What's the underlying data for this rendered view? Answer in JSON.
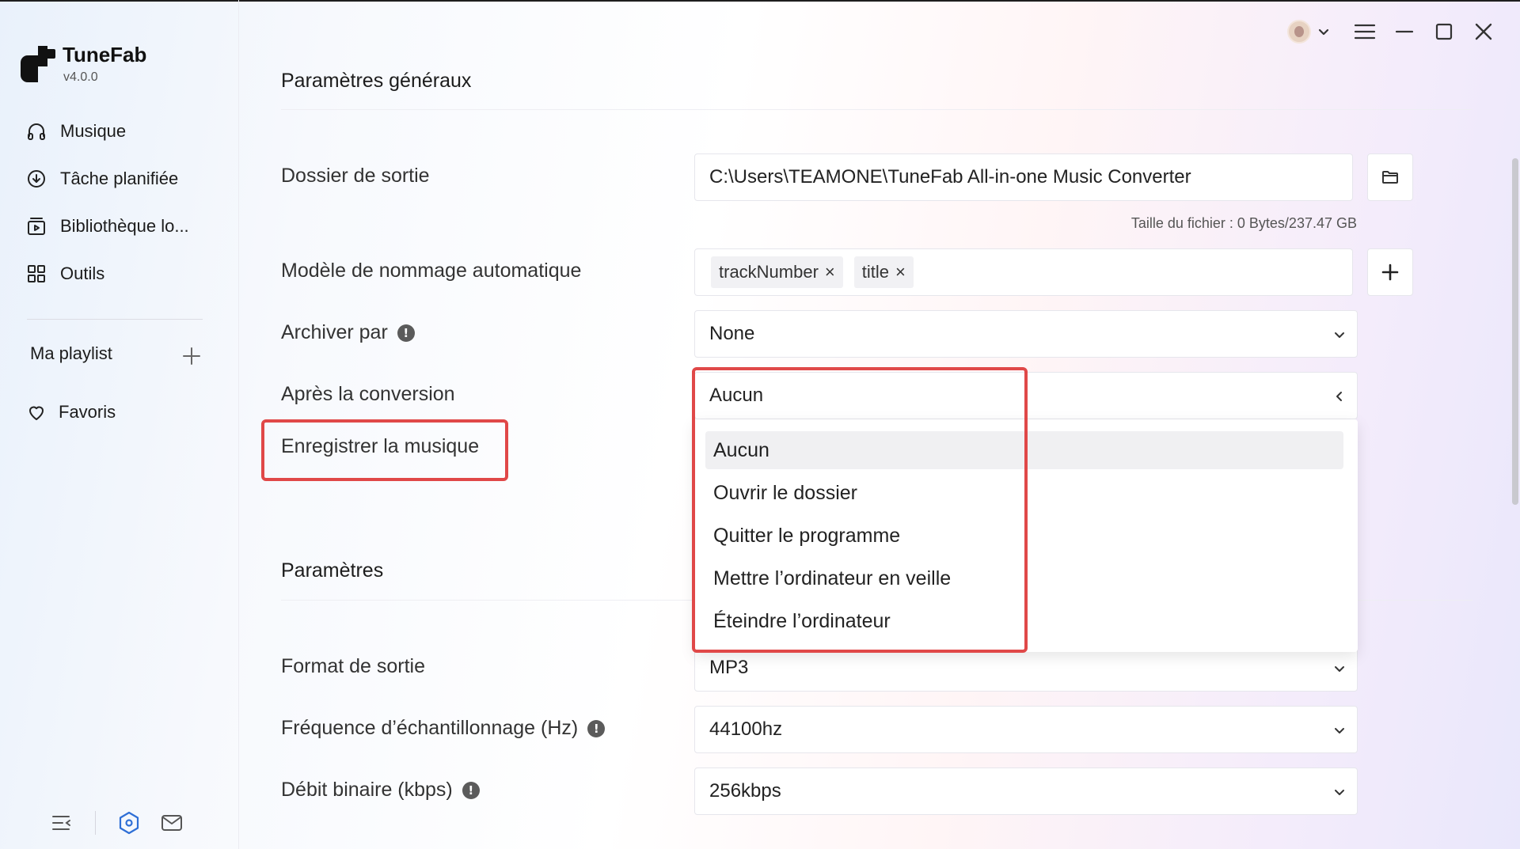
{
  "app": {
    "name": "TuneFab",
    "version": "v4.0.0"
  },
  "sidebar": {
    "items": [
      {
        "label": "Musique",
        "icon": "headphones-icon"
      },
      {
        "label": "Tâche planifiée",
        "icon": "download-circle-icon"
      },
      {
        "label": "Bibliothèque lo...",
        "icon": "library-icon"
      },
      {
        "label": "Outils",
        "icon": "grid-icon"
      }
    ],
    "playlist_label": "Ma playlist",
    "favorites_label": "Favoris"
  },
  "general": {
    "title": "Paramètres généraux",
    "output_folder": {
      "label": "Dossier de sortie",
      "value": "C:\\Users\\TEAMONE\\TuneFab All-in-one Music Converter"
    },
    "file_size": "Taille du fichier : 0 Bytes/237.47 GB",
    "naming": {
      "label": "Modèle de nommage automatique",
      "chips": [
        "trackNumber",
        "title"
      ]
    },
    "archive": {
      "label": "Archiver par",
      "value": "None"
    },
    "after_conversion": {
      "label": "Après la conversion",
      "value": "Aucun",
      "options": [
        "Aucun",
        "Ouvrir le dossier",
        "Quitter le programme",
        "Mettre l’ordinateur en veille",
        "Éteindre l’ordinateur"
      ]
    },
    "save_music_label": "Enregistrer la musique"
  },
  "params": {
    "title": "Paramètres",
    "format": {
      "label": "Format de sortie",
      "value": "MP3"
    },
    "sample_rate": {
      "label": "Fréquence d’échantillonnage (Hz)",
      "value": "44100hz"
    },
    "bitrate": {
      "label": "Débit binaire (kbps)",
      "value": "256kbps"
    }
  },
  "colors": {
    "highlight_box": "#e04848",
    "accent_blue": "#2e6fd6"
  }
}
